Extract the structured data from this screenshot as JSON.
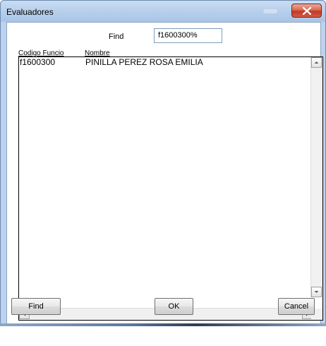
{
  "window": {
    "title": "Evaluadores"
  },
  "search": {
    "label": "Find",
    "value": "f1600300%"
  },
  "list": {
    "columns": [
      "Codigo Funcio",
      "Nombre"
    ],
    "rows": [
      [
        "f1600300",
        "PINILLA PEREZ ROSA EMILIA"
      ]
    ]
  },
  "buttons": {
    "find": "Find",
    "ok": "OK",
    "cancel": "Cancel"
  },
  "colors": {
    "close_button": "#c0392b",
    "titlebar": "#b9d0ec"
  },
  "icons": [
    "close-icon",
    "scroll-up-arrow-icon",
    "scroll-down-arrow-icon",
    "scroll-left-arrow-icon",
    "scroll-right-arrow-icon"
  ]
}
